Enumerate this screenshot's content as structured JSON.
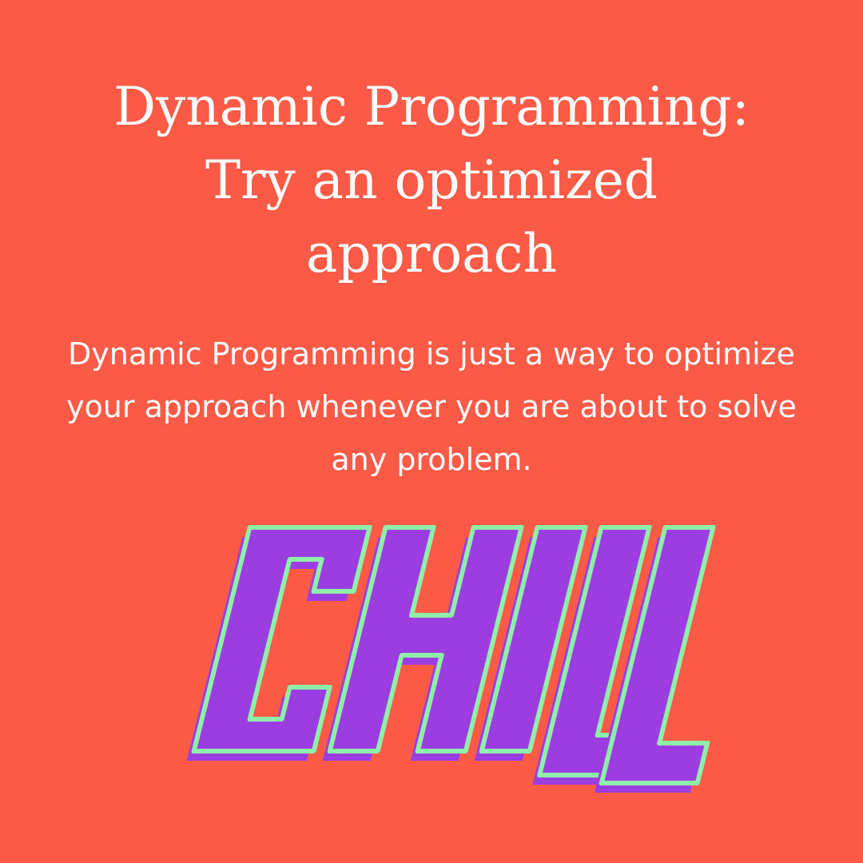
{
  "title": {
    "line1": "Dynamic Programming:",
    "line2": "Try an optimized",
    "line3": "approach"
  },
  "body": {
    "line1": "Dynamic Programming is just a way to optimize",
    "line2": "your approach whenever you are about to solve",
    "line3": "any problem."
  },
  "graphic": {
    "word": "CHILL",
    "fill_color": "#9b3de0",
    "outline_color": "#8ef0a8",
    "shadow_color": "#e2473b"
  },
  "colors": {
    "background": "#fb5b46",
    "text": "#ffffff"
  }
}
